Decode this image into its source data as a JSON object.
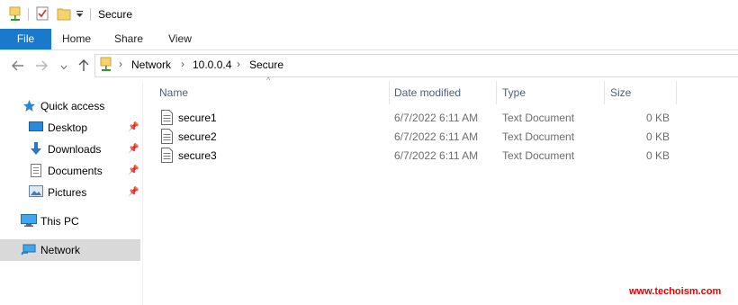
{
  "window": {
    "title": "Secure"
  },
  "ribbon": {
    "tabs": [
      "File",
      "Home",
      "Share",
      "View"
    ]
  },
  "address": {
    "crumbs": [
      "Network",
      "10.0.0.4",
      "Secure"
    ]
  },
  "nav": {
    "quick_access": "Quick access",
    "items": [
      {
        "label": "Desktop",
        "icon": "desktop-icon",
        "pinned": true
      },
      {
        "label": "Downloads",
        "icon": "downloads-icon",
        "pinned": true
      },
      {
        "label": "Documents",
        "icon": "documents-icon",
        "pinned": true
      },
      {
        "label": "Pictures",
        "icon": "pictures-icon",
        "pinned": true
      }
    ],
    "this_pc": "This PC",
    "network": "Network"
  },
  "columns": {
    "name": "Name",
    "date": "Date modified",
    "type": "Type",
    "size": "Size"
  },
  "files": [
    {
      "name": "secure1",
      "date": "6/7/2022 6:11 AM",
      "type": "Text Document",
      "size": "0 KB"
    },
    {
      "name": "secure2",
      "date": "6/7/2022 6:11 AM",
      "type": "Text Document",
      "size": "0 KB"
    },
    {
      "name": "secure3",
      "date": "6/7/2022 6:11 AM",
      "type": "Text Document",
      "size": "0 KB"
    }
  ],
  "watermark": "www.techoism.com",
  "colors": {
    "file_tab": "#1979ca",
    "selected": "#d9d9d9",
    "watermark": "#e60000"
  }
}
